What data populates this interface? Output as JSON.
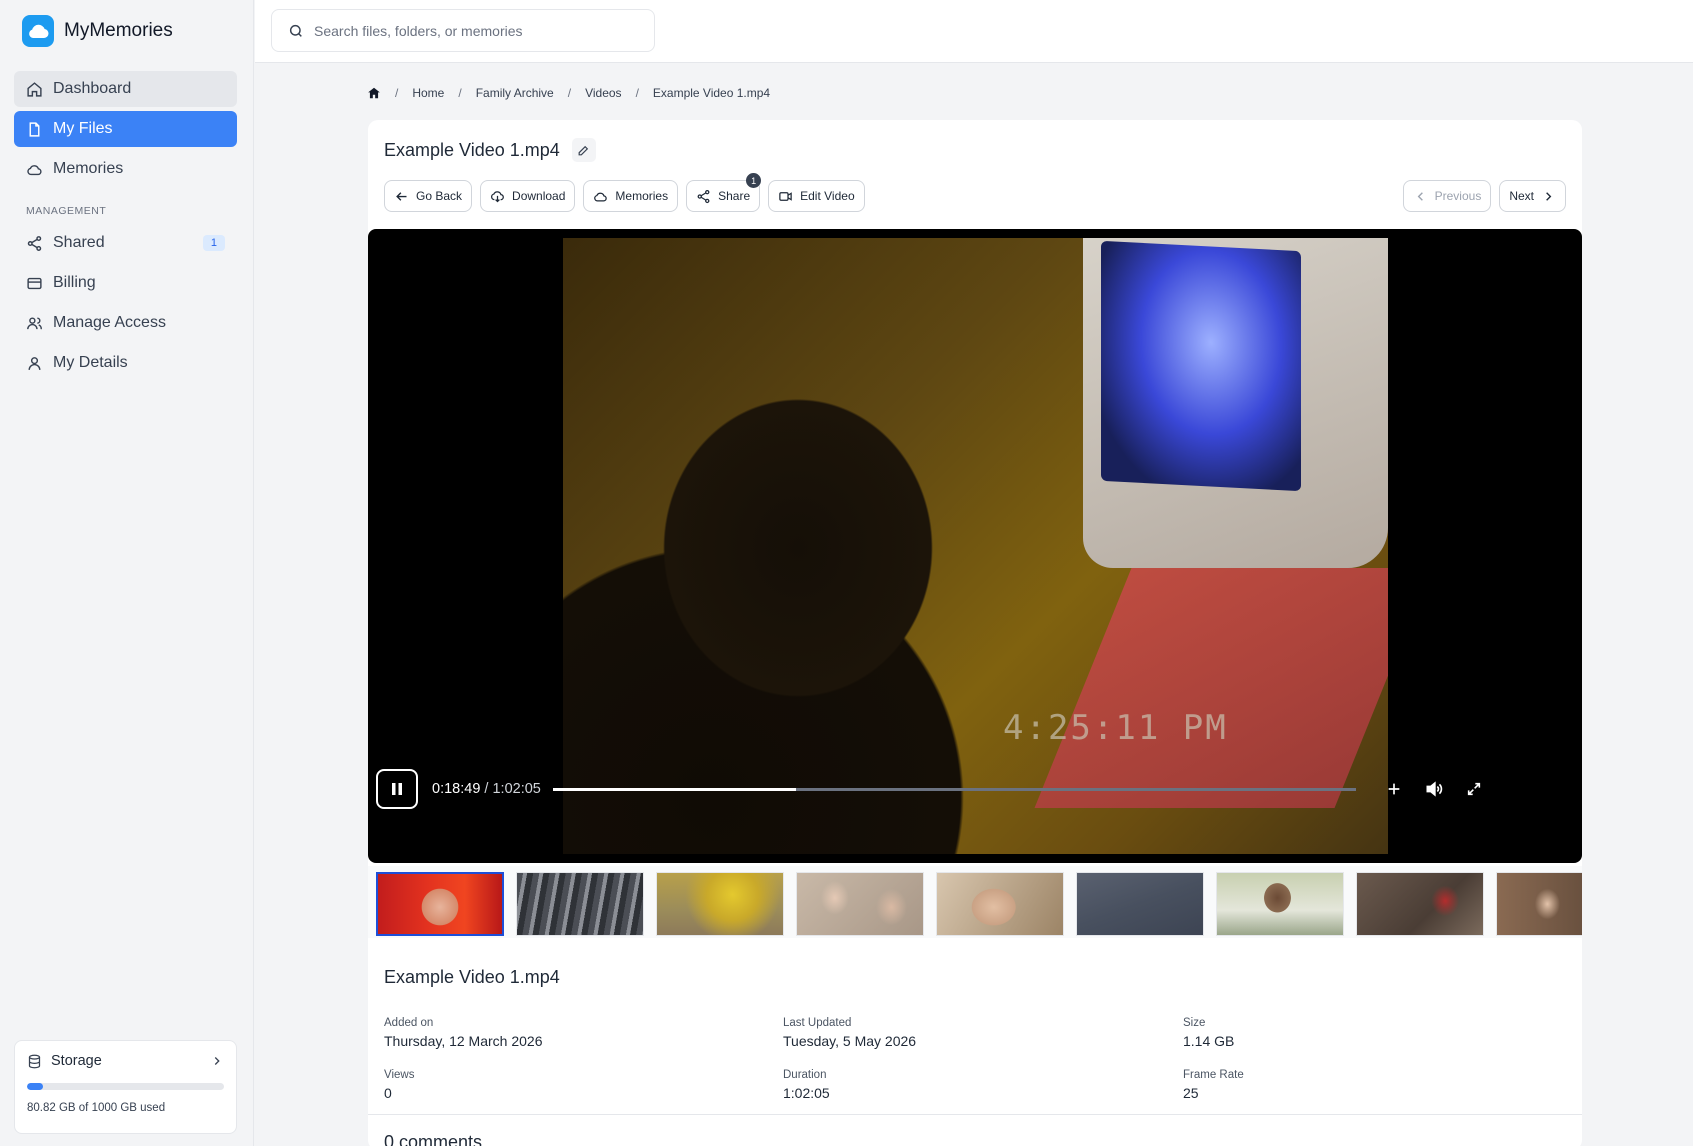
{
  "app": {
    "name": "MyMemories"
  },
  "colors": {
    "accent": "#3b82f6",
    "brand": "#1d9bf0"
  },
  "sidebar": {
    "items": [
      {
        "label": "Dashboard",
        "icon": "home-icon"
      },
      {
        "label": "My Files",
        "icon": "file-icon"
      },
      {
        "label": "Memories",
        "icon": "cloud-icon"
      }
    ],
    "section_label": "MANAGEMENT",
    "management": [
      {
        "label": "Shared",
        "icon": "share-icon",
        "badge": "1"
      },
      {
        "label": "Billing",
        "icon": "credit-card-icon"
      },
      {
        "label": "Manage Access",
        "icon": "users-icon"
      },
      {
        "label": "My Details",
        "icon": "user-icon"
      }
    ],
    "storage": {
      "label": "Storage",
      "used_text": "80.82 GB of 1000 GB used",
      "used_fraction": 0.081
    }
  },
  "search": {
    "placeholder": "Search files, folders, or memories"
  },
  "breadcrumb": [
    "Home",
    "Family Archive",
    "Videos",
    "Example Video 1.mp4"
  ],
  "file": {
    "title": "Example Video 1.mp4"
  },
  "actions": {
    "go_back": "Go Back",
    "download": "Download",
    "memories": "Memories",
    "share": "Share",
    "share_badge": "1",
    "edit_video": "Edit Video",
    "previous": "Previous",
    "next": "Next"
  },
  "player": {
    "current_time": "0:18:49",
    "total_time": "1:02:05",
    "progress_fraction": 0.303,
    "overlay_timestamp": "4:25:11 PM"
  },
  "details": {
    "title": "Example Video 1.mp4",
    "added_on_label": "Added on",
    "added_on": "Thursday, 12 March 2026",
    "last_updated_label": "Last Updated",
    "last_updated": "Tuesday, 5 May 2026",
    "size_label": "Size",
    "size": "1.14 GB",
    "views_label": "Views",
    "views": "0",
    "duration_label": "Duration",
    "duration": "1:02:05",
    "frame_rate_label": "Frame Rate",
    "frame_rate": "25"
  },
  "comments": {
    "title": "0 comments"
  }
}
